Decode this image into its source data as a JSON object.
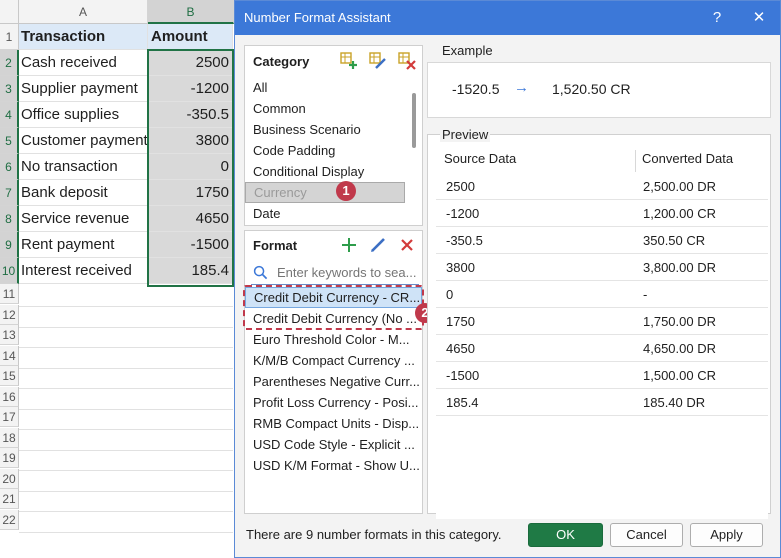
{
  "sheet": {
    "columns": [
      "A",
      "B"
    ],
    "headers": {
      "a": "Transaction",
      "b": "Amount"
    },
    "rows": [
      {
        "n": "2",
        "a": "Cash received",
        "b": "2500"
      },
      {
        "n": "3",
        "a": "Supplier payment",
        "b": "-1200"
      },
      {
        "n": "4",
        "a": "Office supplies",
        "b": "-350.5"
      },
      {
        "n": "5",
        "a": "Customer payment",
        "b": "3800"
      },
      {
        "n": "6",
        "a": "No transaction",
        "b": "0"
      },
      {
        "n": "7",
        "a": "Bank deposit",
        "b": "1750"
      },
      {
        "n": "8",
        "a": "Service revenue",
        "b": "4650"
      },
      {
        "n": "9",
        "a": "Rent payment",
        "b": "-1500"
      },
      {
        "n": "10",
        "a": "Interest received",
        "b": "185.4"
      }
    ],
    "row_numbers": [
      "1",
      "2",
      "3",
      "4",
      "5",
      "6",
      "7",
      "8",
      "9",
      "10",
      "11",
      "12",
      "13",
      "14",
      "15",
      "16",
      "17",
      "18",
      "19",
      "20",
      "21",
      "22"
    ]
  },
  "dialog": {
    "title": "Number Format Assistant",
    "help": "?",
    "close": "✕",
    "category": {
      "title": "Category",
      "items": [
        "All",
        "Common",
        "Business Scenario",
        "Code Padding",
        "Conditional Display",
        "Currency",
        "Date"
      ],
      "badge": "1"
    },
    "format": {
      "title": "Format",
      "search_placeholder": "Enter keywords to sea...",
      "items": [
        "Credit Debit Currency - CR...",
        "Credit Debit Currency (No ...",
        "Euro Threshold Color - M...",
        "K/M/B Compact Currency ...",
        "Parentheses Negative Curr...",
        "Profit Loss Currency - Posi...",
        "RMB Compact Units - Disp...",
        "USD Code Style - Explicit ...",
        "USD K/M Format - Show U..."
      ],
      "badge": "2"
    },
    "example": {
      "label": "Example",
      "source": "-1520.5",
      "arrow": "→",
      "result": "1,520.50 CR"
    },
    "preview": {
      "label": "Preview",
      "col_source": "Source Data",
      "col_converted": "Converted Data",
      "rows": [
        {
          "src": "2500",
          "dst": "2,500.00 DR"
        },
        {
          "src": "-1200",
          "dst": "1,200.00 CR"
        },
        {
          "src": "-350.5",
          "dst": "350.50 CR"
        },
        {
          "src": "3800",
          "dst": "3,800.00 DR"
        },
        {
          "src": "0",
          "dst": "-"
        },
        {
          "src": "1750",
          "dst": "1,750.00 DR"
        },
        {
          "src": "4650",
          "dst": "4,650.00 DR"
        },
        {
          "src": "-1500",
          "dst": "1,500.00 CR"
        },
        {
          "src": "185.4",
          "dst": "185.40 DR"
        }
      ]
    },
    "footer": {
      "status": "There are 9 number formats in this category.",
      "ok": "OK",
      "cancel": "Cancel",
      "apply": "Apply"
    }
  },
  "colors": {
    "title_bar": "#3c78d8",
    "ok_button": "#1f7a45",
    "excel_green": "#217346",
    "annotation_red": "#c0394b"
  }
}
